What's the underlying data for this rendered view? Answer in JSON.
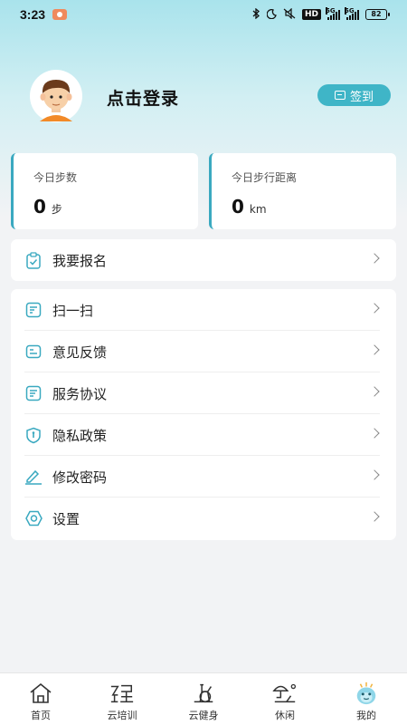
{
  "status_bar": {
    "time": "3:23",
    "hd_label": "HD",
    "network_1": "5G",
    "network_2": "5G",
    "battery": "82"
  },
  "profile": {
    "login_label": "点击登录",
    "signin_button": "签到"
  },
  "stats": [
    {
      "label": "今日步数",
      "value": "0",
      "unit": "步"
    },
    {
      "label": "今日步行距离",
      "value": "0",
      "unit": "km"
    }
  ],
  "signup": {
    "label": "我要报名",
    "icon": "clipboard-check-icon"
  },
  "menu": [
    {
      "label": "扫一扫",
      "icon": "note-icon"
    },
    {
      "label": "意见反馈",
      "icon": "feedback-icon"
    },
    {
      "label": "服务协议",
      "icon": "agreement-icon"
    },
    {
      "label": "隐私政策",
      "icon": "shield-icon"
    },
    {
      "label": "修改密码",
      "icon": "pencil-icon"
    },
    {
      "label": "设置",
      "icon": "gear-icon"
    }
  ],
  "tabs": [
    {
      "label": "首页",
      "icon": "home-icon"
    },
    {
      "label": "云培训",
      "icon": "training-icon"
    },
    {
      "label": "云健身",
      "icon": "bike-icon"
    },
    {
      "label": "休闲",
      "icon": "leisure-icon"
    },
    {
      "label": "我的",
      "icon": "mascot-icon",
      "active": true
    }
  ],
  "colors": {
    "accent": "#3aa9c0",
    "signin_bg": "#3fb5c7",
    "header_gradient_top": "#a9e3ec"
  }
}
